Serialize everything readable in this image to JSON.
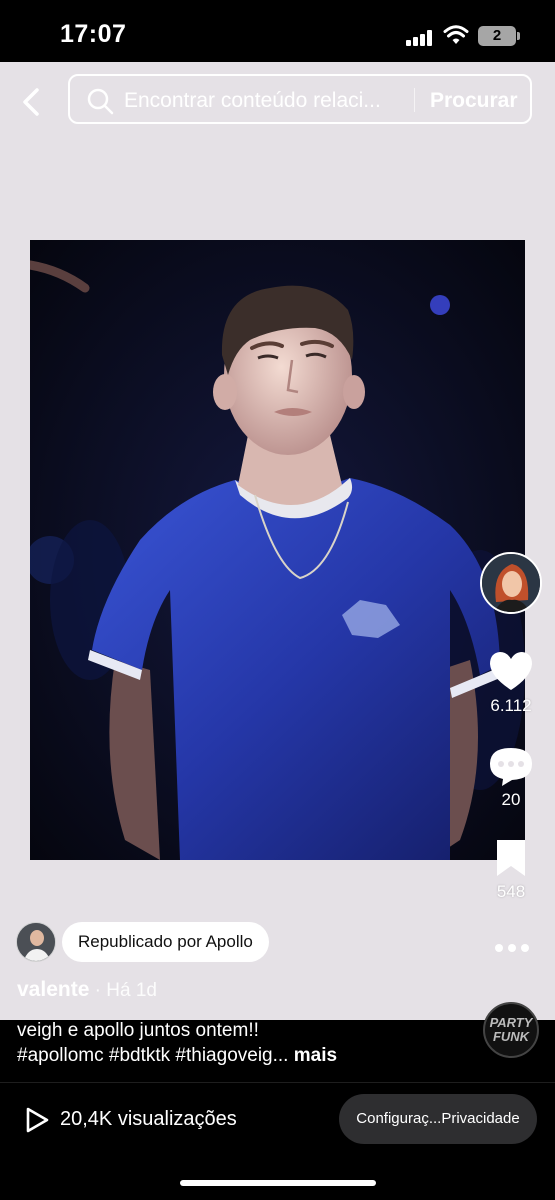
{
  "status_bar": {
    "time": "17:07",
    "battery": "2"
  },
  "search": {
    "placeholder": "Encontrar conteúdo relaci...",
    "button_label": "Procurar"
  },
  "actions": {
    "likes": "6.112",
    "comments": "20",
    "saves": "548"
  },
  "repost": {
    "label": "Republicado por Apollo"
  },
  "post": {
    "author": "valente",
    "time": " · Há 1d",
    "caption_line1": "veigh e apollo juntos ontem!!",
    "caption_line2": "#apollomc #bdtktk #thiagoveig...",
    "more_label": "mais"
  },
  "music": {
    "disc_label_1": "PARTY",
    "disc_label_2": "FUNK"
  },
  "footer": {
    "views": "20,4K visualizações",
    "privacy_label": "Configuraç...Privacidade"
  },
  "colors": {
    "content_bg": "#e5e1e6",
    "photo_bg": "#080a1e",
    "shirt": "#2a3fb5"
  },
  "icons": [
    "chevron-left-icon",
    "search-icon",
    "heart-icon",
    "comment-icon",
    "bookmark-icon",
    "more-icon",
    "play-icon",
    "signal-icon",
    "wifi-icon"
  ]
}
